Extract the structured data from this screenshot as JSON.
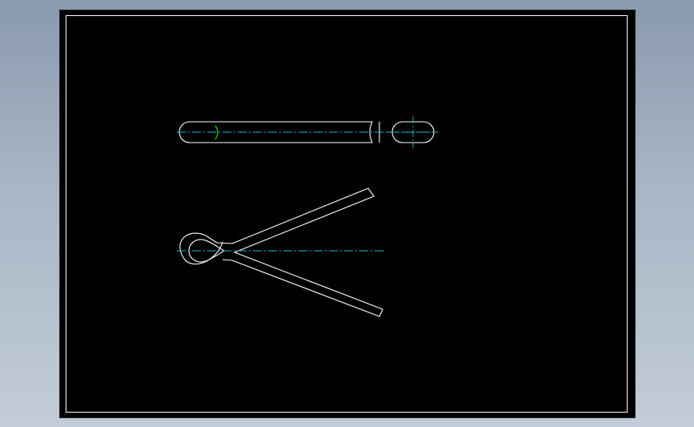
{
  "drawing": {
    "background_color": "#000000",
    "line_color": "#ffffff",
    "centerline_color": "#00c8d2",
    "section_mark_color": "#00ff00"
  }
}
